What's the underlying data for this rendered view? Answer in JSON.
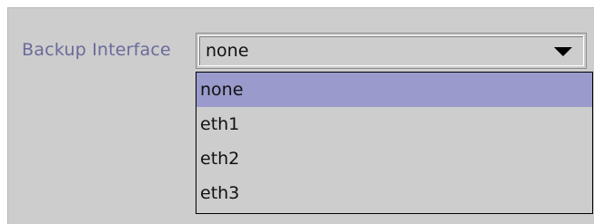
{
  "form": {
    "backup_interface": {
      "label": "Backup Interface",
      "selected_value": "none",
      "options": [
        "none",
        "eth1",
        "eth2",
        "eth3"
      ],
      "highlighted_option": "none"
    }
  },
  "colors": {
    "panel_background": "#cdcdcd",
    "label_text": "#6a6a9c",
    "selection_highlight": "#9a9acc",
    "list_border": "#000000"
  },
  "icons": {
    "combo_arrow": "triangle-down-icon"
  }
}
